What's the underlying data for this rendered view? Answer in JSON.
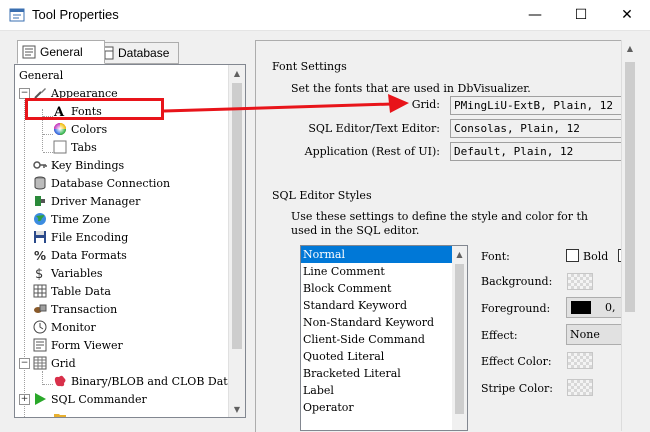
{
  "window": {
    "title": "Tool Properties",
    "minimize_glyph": "—",
    "maximize_glyph": "☐",
    "close_glyph": "✕"
  },
  "tabs": [
    {
      "label": "General",
      "active": true
    },
    {
      "label": "Database",
      "active": false
    }
  ],
  "tree": {
    "items": [
      {
        "label": "General",
        "icon": "none"
      },
      {
        "label": "Appearance",
        "icon": "brush-icon"
      },
      {
        "label": "Fonts",
        "icon": "font-icon"
      },
      {
        "label": "Colors",
        "icon": "color-wheel-icon"
      },
      {
        "label": "Tabs",
        "icon": "tab-icon"
      },
      {
        "label": "Key Bindings",
        "icon": "key-icon"
      },
      {
        "label": "Database Connection",
        "icon": "database-icon"
      },
      {
        "label": "Driver Manager",
        "icon": "driver-icon"
      },
      {
        "label": "Time Zone",
        "icon": "globe-icon"
      },
      {
        "label": "File Encoding",
        "icon": "floppy-icon"
      },
      {
        "label": "Data Formats",
        "icon": "percent-icon"
      },
      {
        "label": "Variables",
        "icon": "dollar-icon"
      },
      {
        "label": "Table Data",
        "icon": "table-icon"
      },
      {
        "label": "Transaction",
        "icon": "transaction-icon"
      },
      {
        "label": "Monitor",
        "icon": "clock-icon"
      },
      {
        "label": "Form Viewer",
        "icon": "form-icon"
      },
      {
        "label": "Grid",
        "icon": "grid-icon"
      },
      {
        "label": "Binary/BLOB and CLOB Data",
        "icon": "blob-icon"
      },
      {
        "label": "SQL Commander",
        "icon": "play-icon"
      }
    ]
  },
  "font_settings": {
    "title": "Font Settings",
    "description": "Set the fonts that are used in DbVisualizer.",
    "rows": [
      {
        "label": "Grid:",
        "value": "PMingLiU-ExtB, Plain, 12"
      },
      {
        "label": "SQL Editor/Text Editor:",
        "value": "Consolas, Plain, 12"
      },
      {
        "label": "Application (Rest of UI):",
        "value": "Default, Plain, 12"
      }
    ]
  },
  "sql_styles": {
    "title": "SQL Editor Styles",
    "description_line1": "Use these settings to define the style and color for th",
    "description_line2": "used in the SQL editor.",
    "styles": [
      "Normal",
      "Line Comment",
      "Block Comment",
      "Standard Keyword",
      "Non-Standard Keyword",
      "Client-Side Command",
      "Quoted Literal",
      "Bracketed Literal",
      "Label",
      "Operator"
    ],
    "selected_index": 0,
    "props": {
      "font_label": "Font:",
      "bold_label": "Bold",
      "background_label": "Background:",
      "foreground_label": "Foreground:",
      "foreground_suffix": "0,",
      "effect_label": "Effect:",
      "effect_value": "None",
      "effect_color_label": "Effect Color:",
      "stripe_color_label": "Stripe Color:"
    }
  },
  "colors": {
    "selection": "#0078d7",
    "annotation": "#e8141a"
  }
}
